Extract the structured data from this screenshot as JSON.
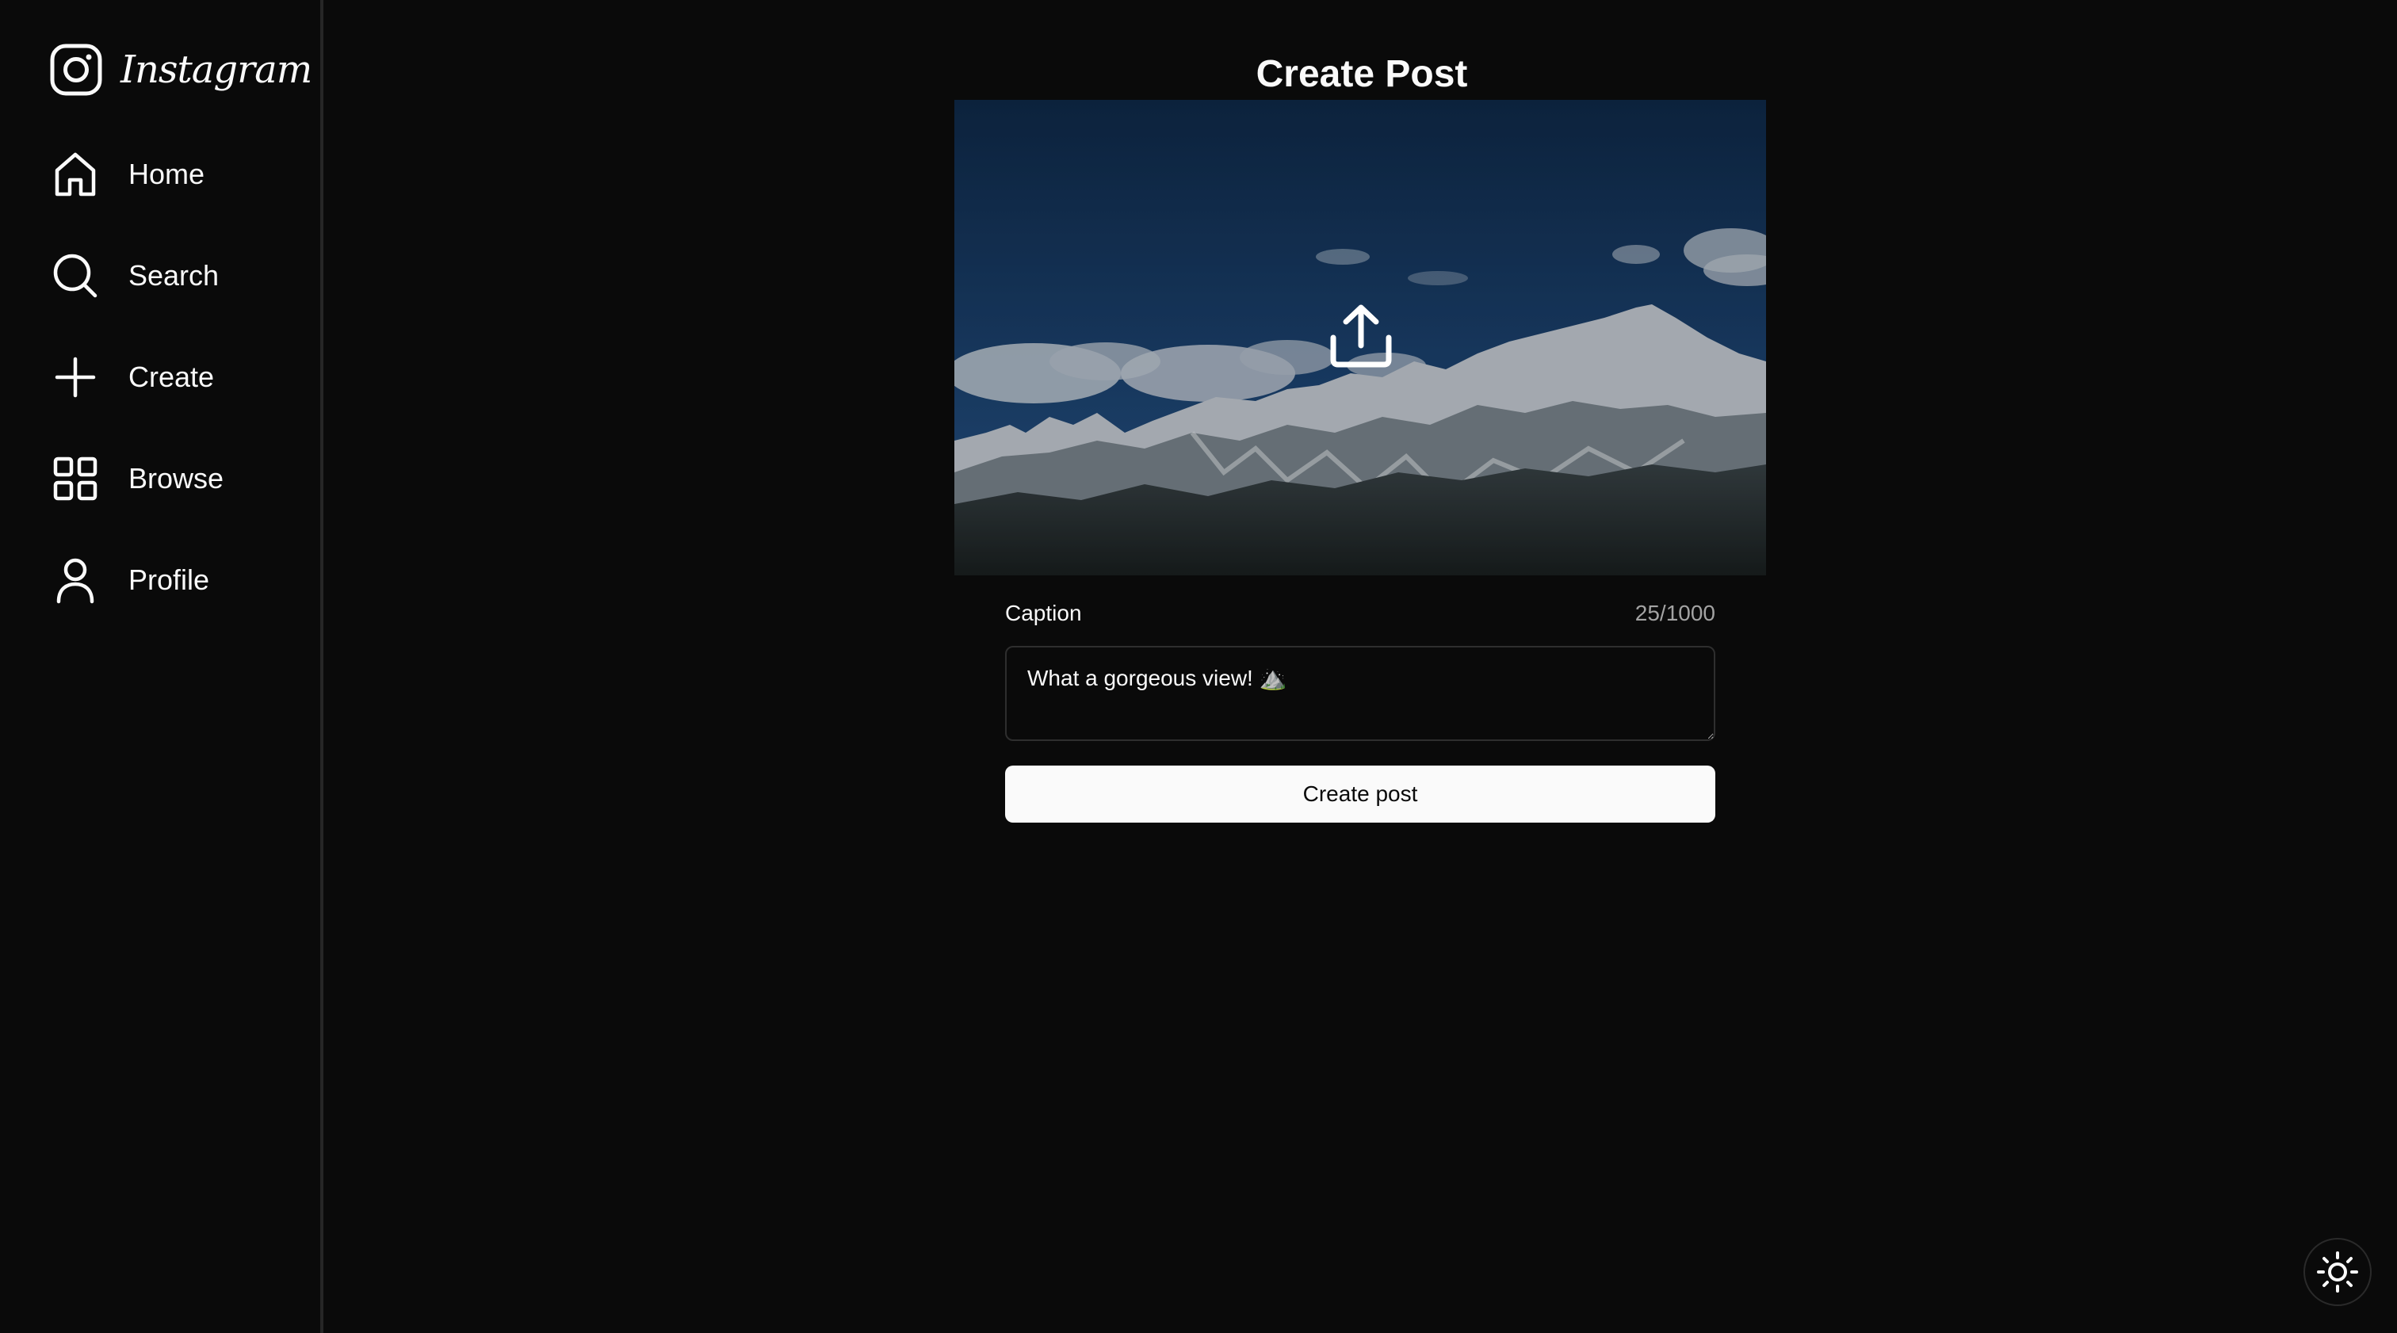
{
  "brand": {
    "name": "Instagram",
    "icon": "instagram-logo-icon"
  },
  "sidebar": {
    "items": [
      {
        "label": "Home",
        "icon": "home-icon"
      },
      {
        "label": "Search",
        "icon": "search-icon"
      },
      {
        "label": "Create",
        "icon": "plus-icon"
      },
      {
        "label": "Browse",
        "icon": "grid-icon"
      },
      {
        "label": "Profile",
        "icon": "user-icon"
      }
    ]
  },
  "main": {
    "title": "Create Post",
    "upload": {
      "icon": "upload-icon"
    },
    "caption": {
      "label": "Caption",
      "count": "25/1000",
      "value": "What a gorgeous view! ⛰️"
    },
    "submit_label": "Create post"
  },
  "theme_toggle": {
    "icon": "sun-icon"
  },
  "colors": {
    "background": "#0a0a0a",
    "text": "#fafafa",
    "muted": "#a3a3a3",
    "border": "#262626",
    "button_bg": "#fafafa",
    "button_text": "#0a0a0a"
  }
}
